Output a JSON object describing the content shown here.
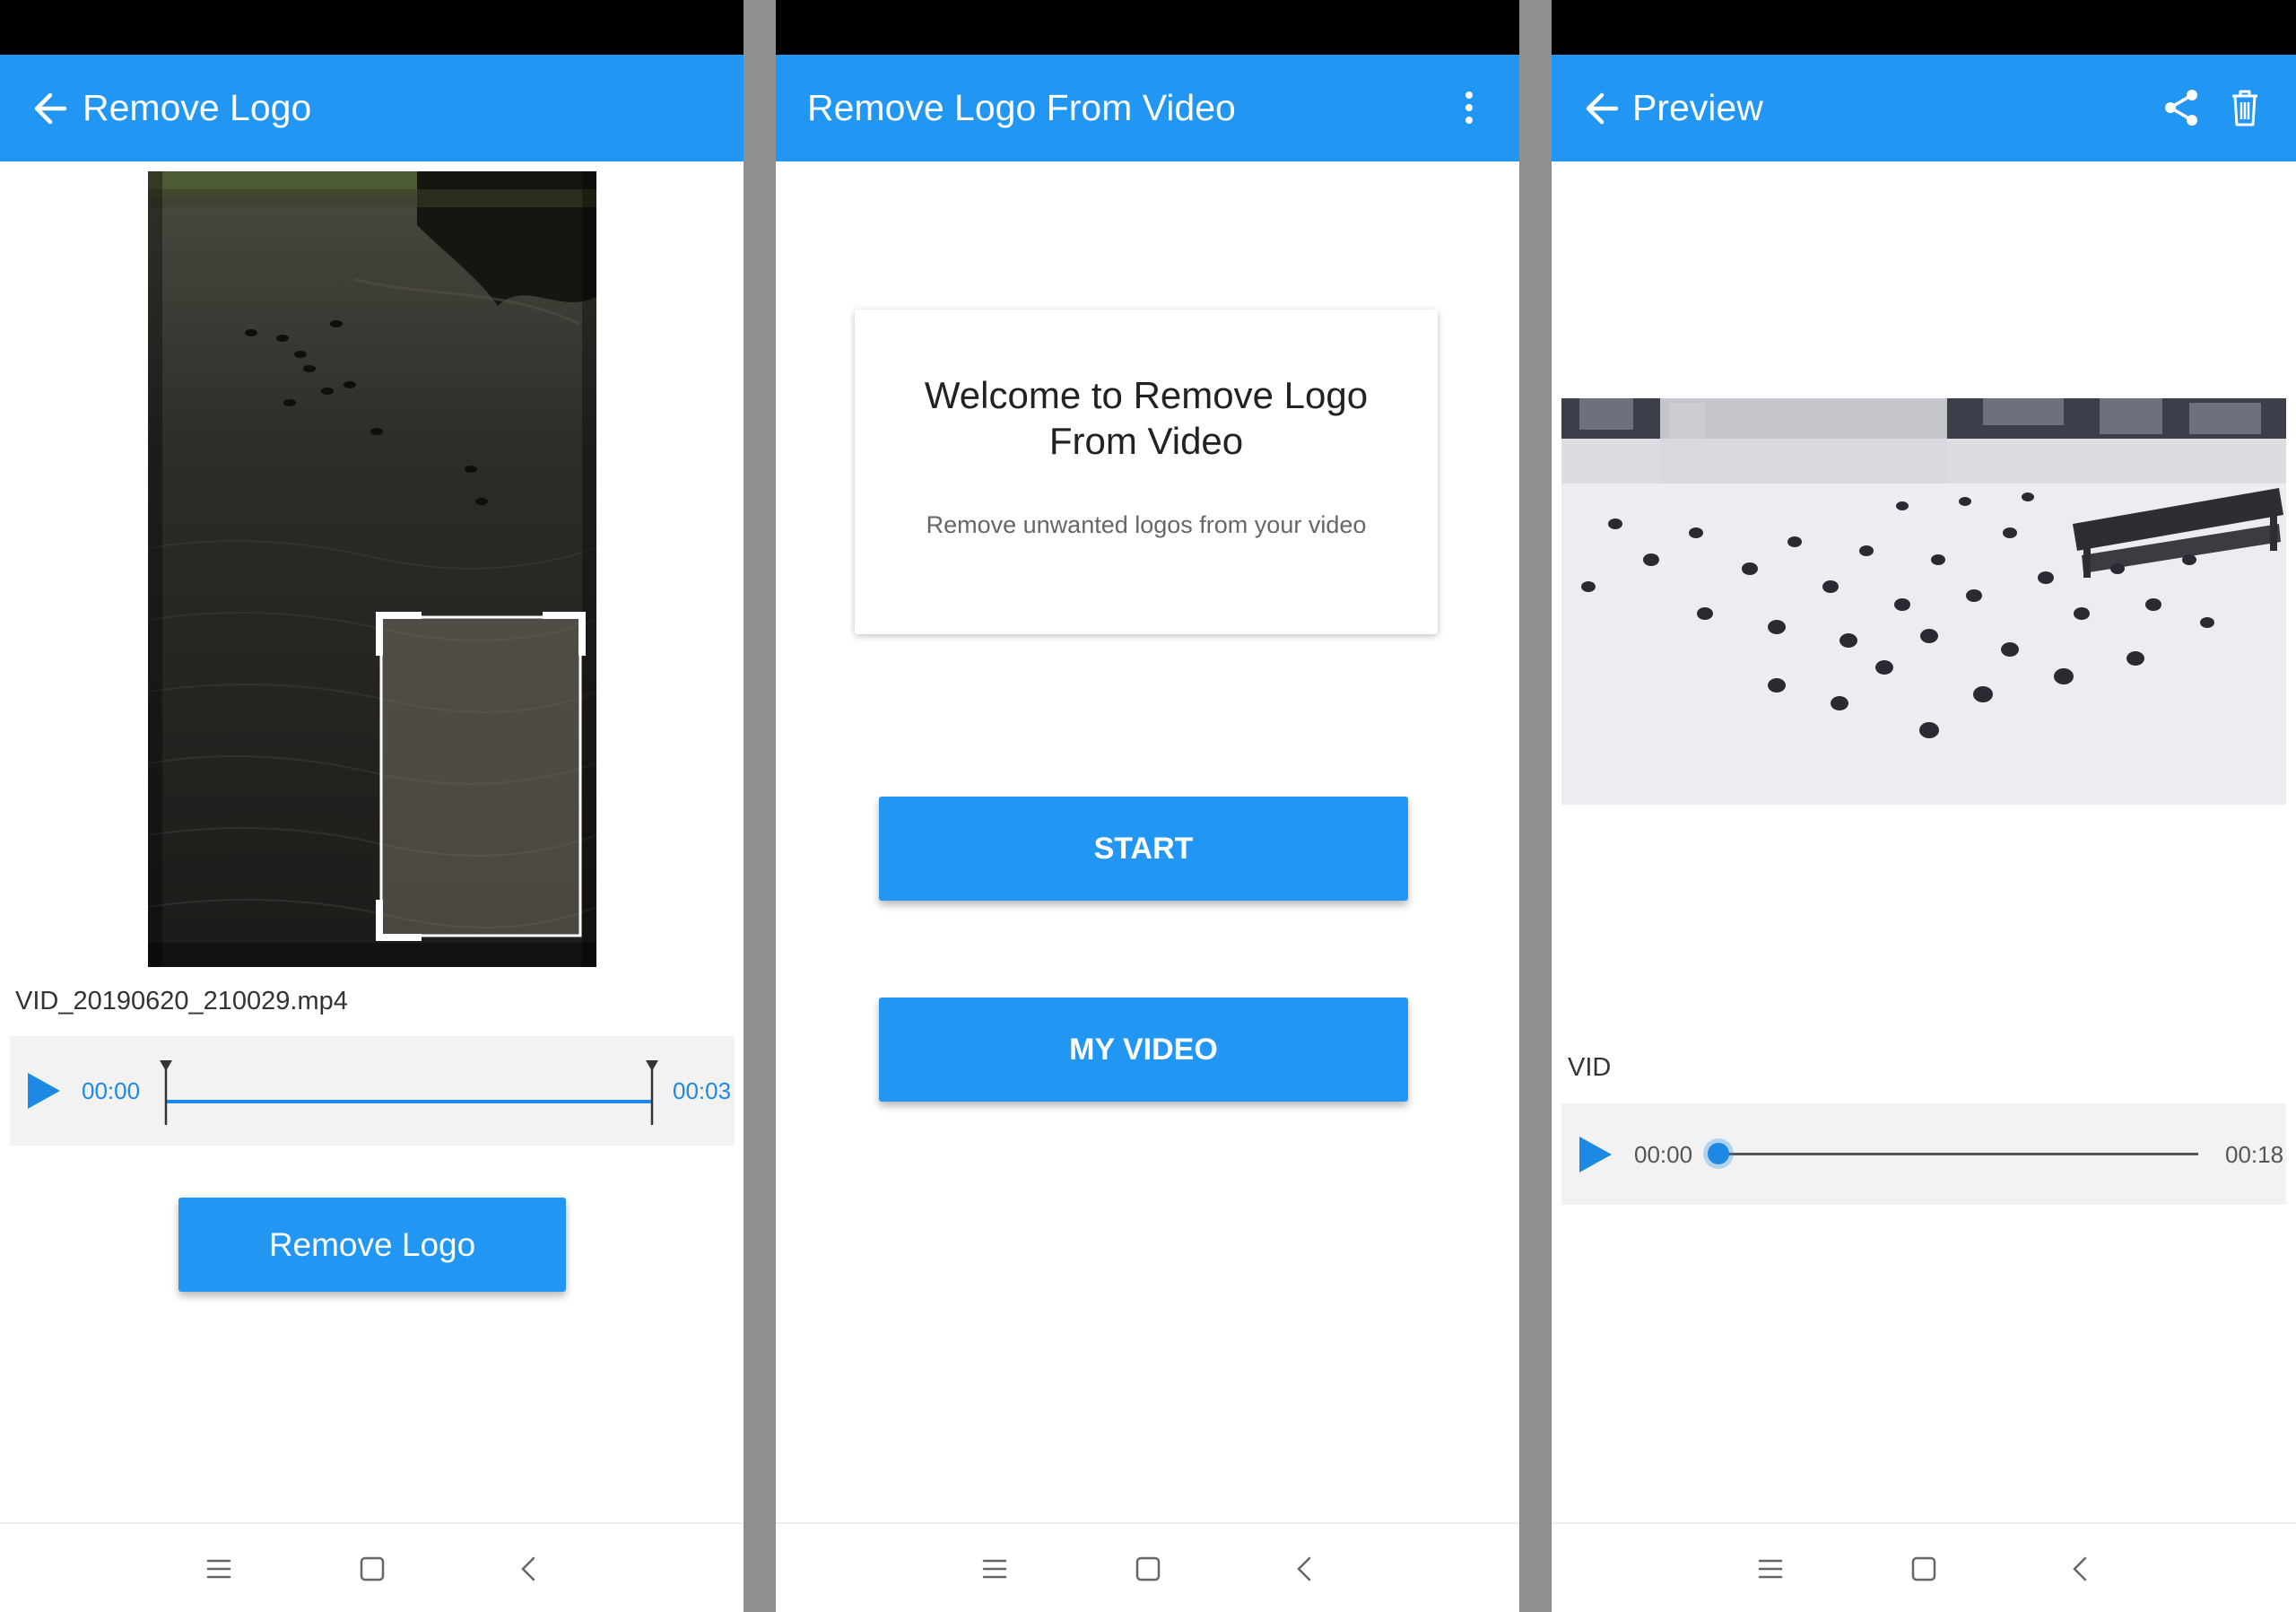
{
  "colors": {
    "accent": "#2196f3",
    "status_bar": "#000000",
    "divider": "#8f8f8f",
    "text_dark": "#333333"
  },
  "screen1": {
    "title": "Remove Logo",
    "back_icon": "arrow-left-icon",
    "filename": "VID_20190620_210029.mp4",
    "time_start": "00:00",
    "time_end": "00:03",
    "button": "Remove Logo"
  },
  "screen2": {
    "title": "Remove Logo From Video",
    "menu_icon": "more-vertical-icon",
    "card_title_line1": "Welcome to Remove Logo",
    "card_title_line2": "From Video",
    "card_subtitle": "Remove unwanted logos from your video",
    "start_button": "START",
    "my_video_button": "MY VIDEO"
  },
  "screen3": {
    "title": "Preview",
    "share_icon": "share-icon",
    "delete_icon": "trash-icon",
    "filename": "VID",
    "time_start": "00:00",
    "time_end": "00:18",
    "progress": 0
  },
  "nav_icons": [
    "menu-icon",
    "home-icon",
    "back-icon"
  ]
}
